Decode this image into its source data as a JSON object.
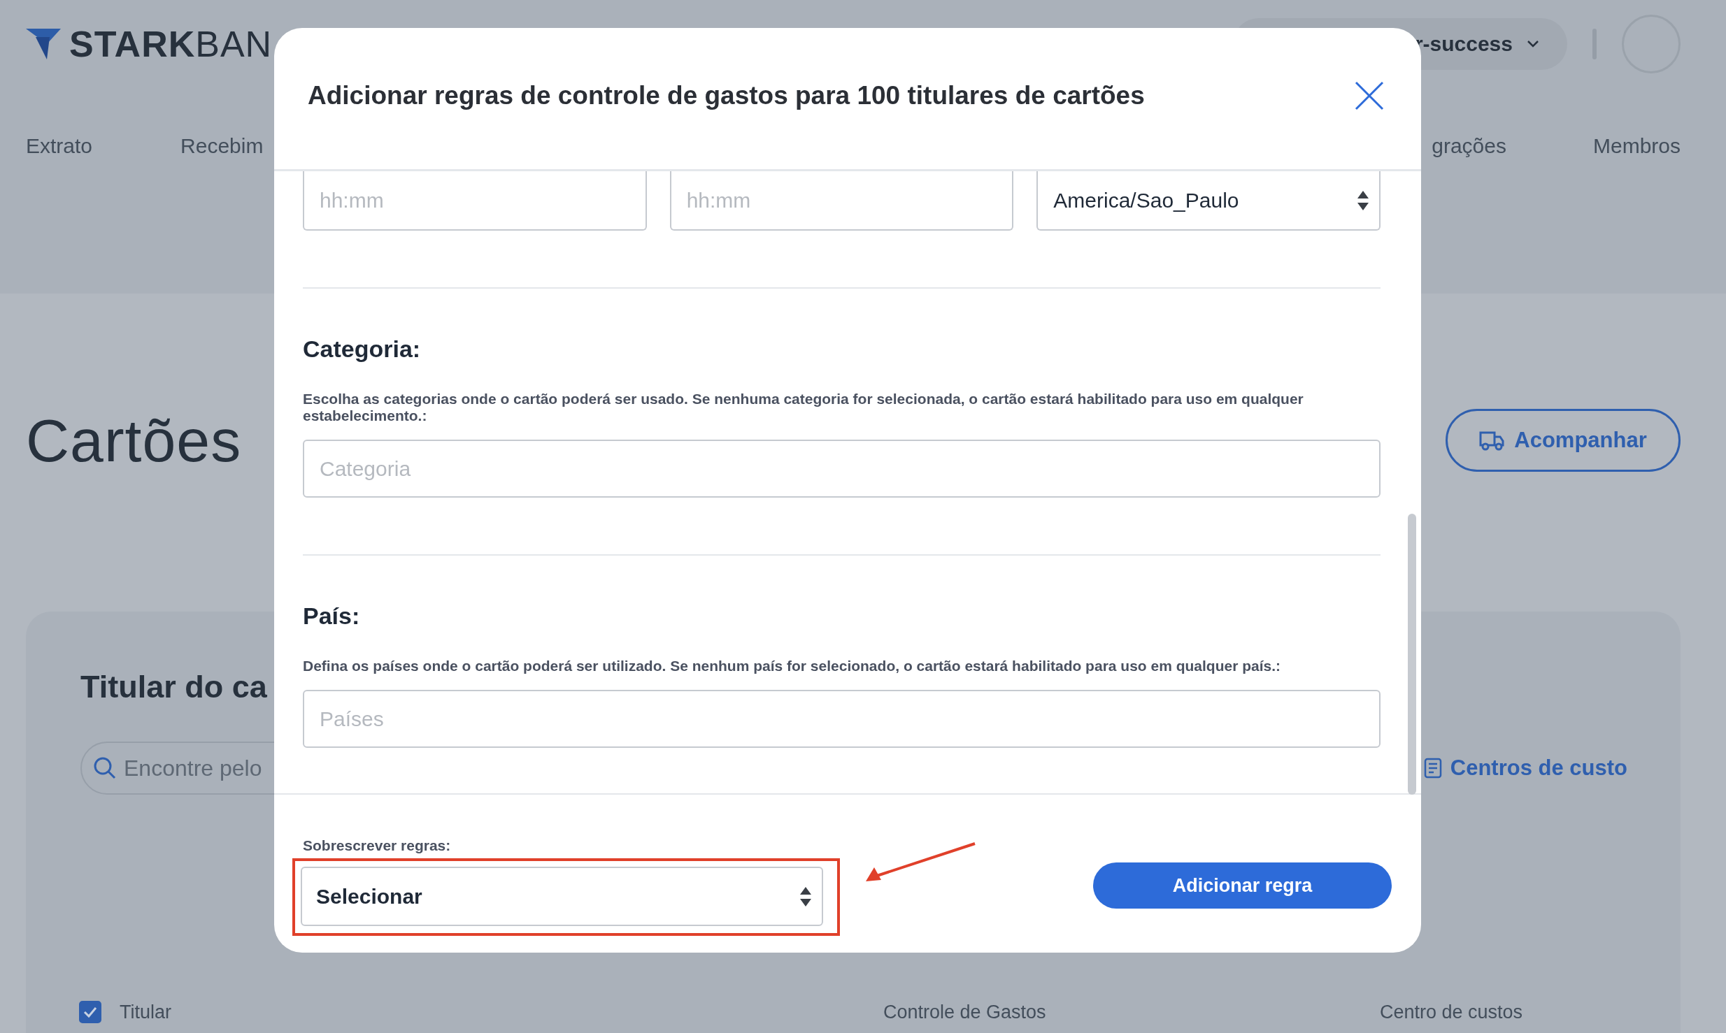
{
  "background": {
    "logo": "**STARK**BAN",
    "nav": [
      "Extrato",
      "Recebim",
      "grações",
      "Membros"
    ],
    "user": "r-success",
    "page_title": "Cartões",
    "track_button": "Acompanhar",
    "card_title": "Titular do ca",
    "search_placeholder": "Encontre pelo",
    "cost_centers_link": "Centros de custo",
    "select_all_checked": true,
    "table_columns": [
      {
        "label": "Titular"
      },
      {
        "label": "Controle de Gastos"
      },
      {
        "label": "Centro de custos"
      }
    ]
  },
  "modal": {
    "title": "Adicionar regras de controle de gastos para 100 titulares de cartões",
    "time_fields": [
      {
        "placeholder": "hh:mm"
      },
      {
        "placeholder": "hh:mm"
      }
    ],
    "timezone": "America/Sao_Paulo",
    "sections": [
      {
        "heading": "Categoria:",
        "description": "Escolha as categorias onde o cartão poderá ser usado. Se nenhuma categoria for selecionada, o cartão estará habilitado para uso em qualquer estabelecimento.:",
        "placeholder": "Categoria"
      },
      {
        "heading": "País:",
        "description": "Defina os países onde o cartão poderá ser utilizado. Se nenhum país for selecionado, o cartão estará habilitado para uso em qualquer país.:",
        "placeholder": "Países"
      }
    ],
    "override": {
      "label": "Sobrescrever regras:",
      "value": "Selecionar"
    },
    "submit": "Adicionar regra"
  }
}
